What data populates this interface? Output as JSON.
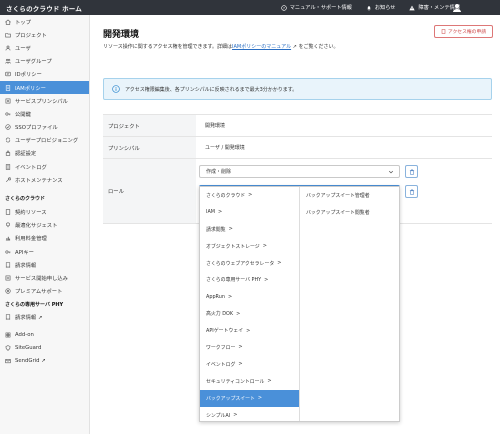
{
  "header": {
    "brand": "さくらのクラウド ホーム",
    "nav": [
      {
        "label": "マニュアル・サポート情報",
        "icon": "help-icon"
      },
      {
        "label": "お知らせ",
        "icon": "bell-icon"
      },
      {
        "label": "障害・メンテ情報",
        "icon": "warning-icon"
      }
    ]
  },
  "sidebar": {
    "items": [
      {
        "label": "トップ",
        "icon": "home-icon"
      },
      {
        "label": "プロジェクト",
        "icon": "folder-icon"
      },
      {
        "label": "ユーザ",
        "icon": "user-icon"
      },
      {
        "label": "ユーザグループ",
        "icon": "users-icon"
      },
      {
        "label": "IDポリシー",
        "icon": "id-icon"
      },
      {
        "label": "IAMポリシー",
        "icon": "policy-icon",
        "active": true
      },
      {
        "label": "サービスプリンシパル",
        "icon": "service-icon"
      },
      {
        "label": "公開鍵",
        "icon": "key-icon"
      },
      {
        "label": "SSOプロファイル",
        "icon": "sso-icon"
      },
      {
        "label": "ユーザープロビジョニング",
        "icon": "sync-icon"
      },
      {
        "label": "認証設定",
        "icon": "lock-icon"
      },
      {
        "label": "イベントログ",
        "icon": "log-icon"
      },
      {
        "label": "ホストメンテナンス",
        "icon": "wrench-icon"
      }
    ],
    "section2_title": "さくらのクラウド",
    "section2": [
      {
        "label": "契約リソース",
        "icon": "doc-icon"
      },
      {
        "label": "最適化サジェスト",
        "icon": "bulb-icon"
      },
      {
        "label": "利用料金管理",
        "icon": "chart-icon"
      },
      {
        "label": "APIキー",
        "icon": "key-icon"
      },
      {
        "label": "請求情報",
        "icon": "receipt-icon"
      },
      {
        "label": "サービス開始申し込み",
        "icon": "form-icon"
      },
      {
        "label": "プレミアムサポート",
        "icon": "support-icon"
      }
    ],
    "section3_title": "さくらの専用サーバ PHY",
    "section3": [
      {
        "label": "請求情報 ↗",
        "icon": "receipt-icon"
      }
    ],
    "section4": [
      {
        "label": "Add-on",
        "icon": "addon-icon"
      },
      {
        "label": "SiteGuard",
        "icon": "shield-icon"
      },
      {
        "label": "SendGrid ↗",
        "icon": "mail-icon"
      }
    ]
  },
  "main": {
    "title": "開発環境",
    "desc_before": "リソース操作に関するアクセス権を管理できます。詳細は",
    "desc_link": "IAMポリシーのマニュアル",
    "desc_after": " ↗ をご覧ください。",
    "request_button": "アクセス権の申請",
    "info": "アクセス権限編集後、各プリンシパルに反映されるまで最大3分かかります。",
    "rows": {
      "project_label": "プロジェクト",
      "project_value": "開発環境",
      "principal_label": "プリンシパル",
      "principal_value": "ユーザ / 開発環境",
      "role_label": "ロール"
    },
    "role_select_1": "作成・削除",
    "role_select_2": ""
  },
  "dropdown": {
    "categories": [
      {
        "label": "さくらのクラウド"
      },
      {
        "label": "IAM"
      },
      {
        "label": "請求閲覧"
      },
      {
        "label": "オブジェクトストレージ"
      },
      {
        "label": "さくらのウェブアクセラレータ"
      },
      {
        "label": "さくらの専用サーバ PHY"
      },
      {
        "label": "AppRun"
      },
      {
        "label": "高火力 DOK"
      },
      {
        "label": "APIゲートウェイ"
      },
      {
        "label": "ワークフロー"
      },
      {
        "label": "イベントログ"
      },
      {
        "label": "セキュリティコントロール"
      },
      {
        "label": "バックアップスイート",
        "selected": true
      },
      {
        "label": "シンプルAI"
      }
    ],
    "roles": [
      {
        "label": "バックアップスイート管理者"
      },
      {
        "label": "バックアップスイート閲覧者"
      }
    ],
    "arrow": ">"
  }
}
